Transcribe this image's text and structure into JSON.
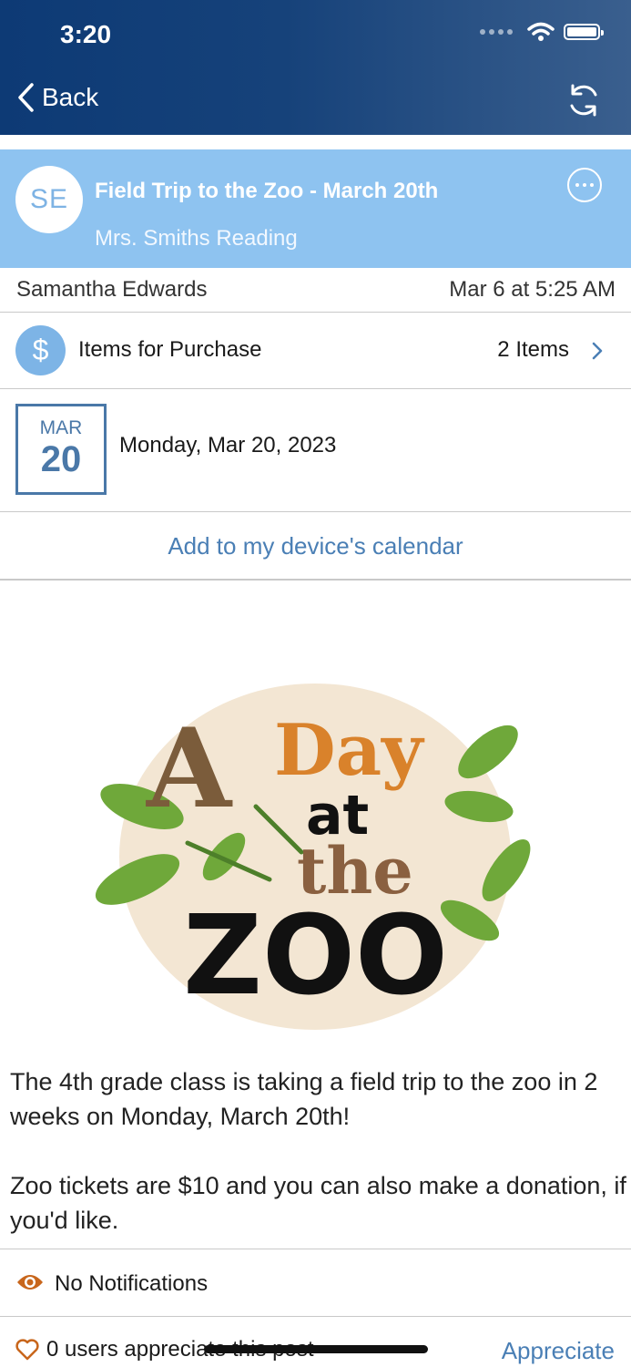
{
  "status_bar": {
    "time": "3:20"
  },
  "nav": {
    "back_label": "Back"
  },
  "post": {
    "initials": "SE",
    "title": "Field Trip to the Zoo - March 20th",
    "group": "Mrs. Smiths Reading",
    "author": "Samantha Edwards",
    "posted": "Mar 6 at 5:25 AM"
  },
  "purchase": {
    "label": "Items for Purchase",
    "count": "2 Items",
    "icon": "dollar-icon"
  },
  "event": {
    "month": "MAR",
    "day": "20",
    "full_date": "Monday, Mar 20, 2023"
  },
  "calendar_link": "Add to my device's calendar",
  "image": {
    "words": [
      "A",
      "Day",
      "at",
      "the",
      "ZOO"
    ]
  },
  "body": {
    "paragraph1": "The 4th grade class is taking a field trip to the zoo in 2 weeks on Monday, March 20th!",
    "paragraph2": "Zoo tickets are $10 and you can also make a donation, if you'd like."
  },
  "notifications": {
    "label": "No Notifications"
  },
  "appreciate": {
    "count_text": "0 users appreciate this post",
    "button": "Appreciate"
  },
  "colors": {
    "nav_gradient_start": "#0d3a75",
    "header_bg": "#8ec3f0",
    "link": "#4a7fb5",
    "accent_orange": "#c8661c"
  }
}
